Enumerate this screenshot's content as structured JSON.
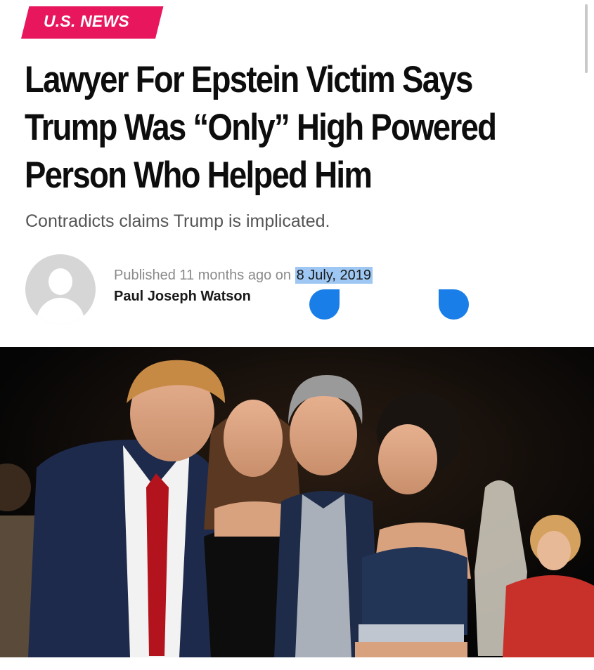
{
  "article": {
    "category": "U.S. NEWS",
    "headline_lines": [
      "Lawyer For Epstein Victim Says",
      "Trump Was “Only” High Powered",
      "Person Who Helped Him"
    ],
    "subtitle": "Contradicts claims Trump is implicated.",
    "meta": {
      "published_prefix": "Published 11 months ago on ",
      "date": "8 July, 2019",
      "author": "Paul Joseph Watson"
    },
    "photo": {
      "description_icon": "photo-image"
    }
  },
  "colors": {
    "category_background": "#e8175d",
    "headline": "#0d0d0d",
    "selection_highlight": "#9ec7f3",
    "selection_handle": "#1a7ee8"
  }
}
